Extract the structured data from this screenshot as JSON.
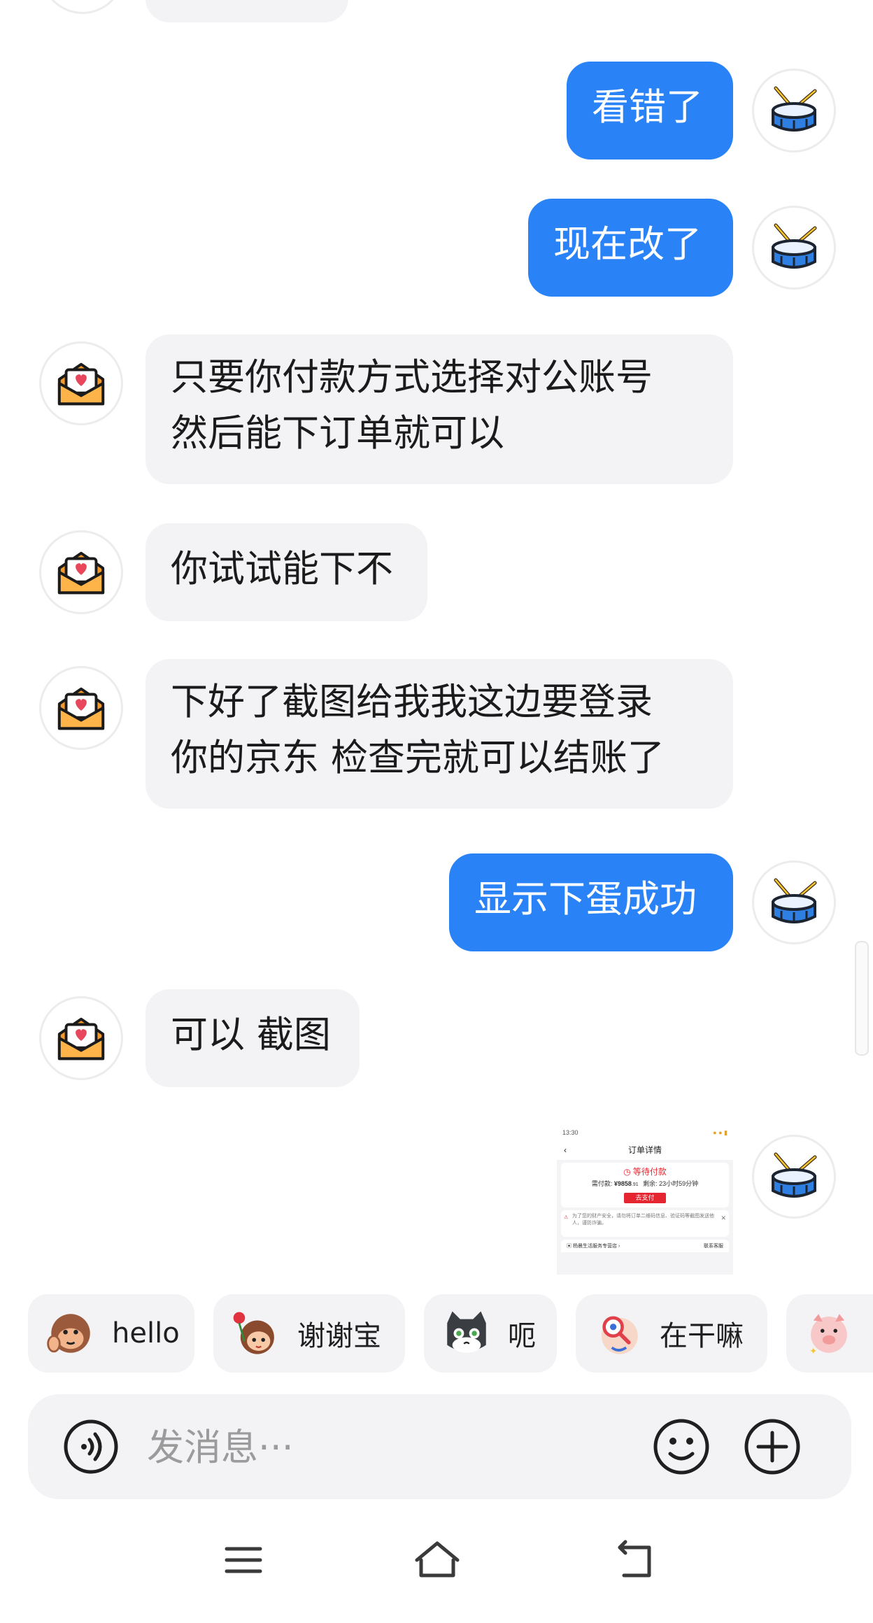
{
  "messages": [
    {
      "side": "me",
      "text": "看错了"
    },
    {
      "side": "me",
      "text": "现在改了"
    },
    {
      "side": "them",
      "lines": [
        "只要你付款方式选择对公账号",
        "然后能下订单就可以"
      ]
    },
    {
      "side": "them",
      "text": "你试试能下不"
    },
    {
      "side": "them",
      "lines": [
        "下好了截图给我我这边要登录",
        "你的京东 检查完就可以结账了"
      ]
    },
    {
      "side": "me",
      "text": "显示下蛋成功"
    },
    {
      "side": "them",
      "text": "可以 截图"
    }
  ],
  "screenshot": {
    "status_time": "13:30",
    "header_title": "订单详情",
    "status": "等待付款",
    "amount_label": "需付款:",
    "amount": "¥9858",
    "amount_cents": ".91",
    "remaining": "剩余: 23小时59分钟",
    "pay_button": "去支付",
    "notice": "为了您的财产安全，请勿将订单二维码信息、验证码等截图发送他人，谨防诈骗。",
    "store_row": "杨晨生活服务专营店",
    "contact": "联系客服"
  },
  "quick_replies": [
    {
      "label": "hello",
      "sticker": "monkey-sticker"
    },
    {
      "label": "谢谢宝",
      "sticker": "rose-girl-sticker"
    },
    {
      "label": "呃",
      "sticker": "cat-sticker"
    },
    {
      "label": "在干嘛",
      "sticker": "magnifier-sticker"
    },
    {
      "label": "",
      "sticker": "pig-sticker"
    }
  ],
  "input": {
    "placeholder": "发消息···"
  },
  "icons": {
    "voice": "voice-icon",
    "emoji": "emoji-icon",
    "plus": "plus-icon",
    "menu": "menu-icon",
    "home": "home-icon",
    "back": "back-icon",
    "self_avatar": "drum-icon",
    "other_avatar": "love-letter-icon"
  },
  "colors": {
    "my_bubble": "#2a82f7",
    "their_bubble": "#f3f3f5",
    "accent_red": "#e5252f"
  }
}
